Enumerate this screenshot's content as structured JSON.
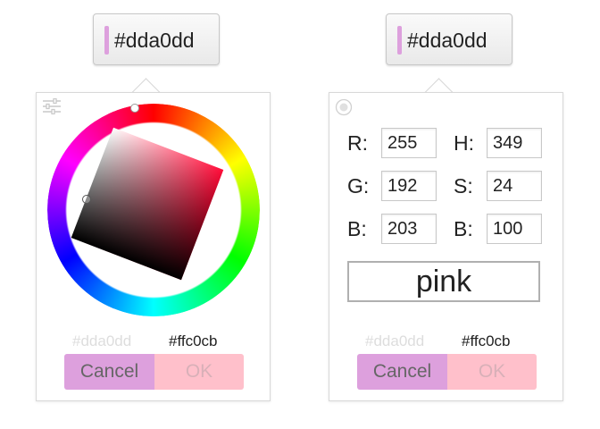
{
  "left_picker": {
    "swatch_button": {
      "value": "#dda0dd",
      "color": "#dda0dd"
    },
    "mode_icon": "sliders-icon",
    "hue_ring_marker_hue_deg": 349,
    "previous_hex": "#dda0dd",
    "current_hex": "#ffc0cb",
    "cancel_label": "Cancel",
    "ok_label": "OK"
  },
  "right_picker": {
    "swatch_button": {
      "value": "#dda0dd",
      "color": "#dda0dd"
    },
    "mode_icon": "color-wheel-icon",
    "fields": {
      "r": {
        "label": "R:",
        "value": "255"
      },
      "g": {
        "label": "G:",
        "value": "192"
      },
      "b": {
        "label": "B:",
        "value": "203"
      },
      "h": {
        "label": "H:",
        "value": "349"
      },
      "s": {
        "label": "S:",
        "value": "24"
      },
      "v": {
        "label": "B:",
        "value": "100"
      }
    },
    "color_name": "pink",
    "previous_hex": "#dda0dd",
    "current_hex": "#ffc0cb",
    "cancel_label": "Cancel",
    "ok_label": "OK"
  },
  "colors": {
    "cancel_bg": "#dda0dd",
    "ok_bg": "#ffc0cb",
    "previous_text": "#dddddd"
  }
}
